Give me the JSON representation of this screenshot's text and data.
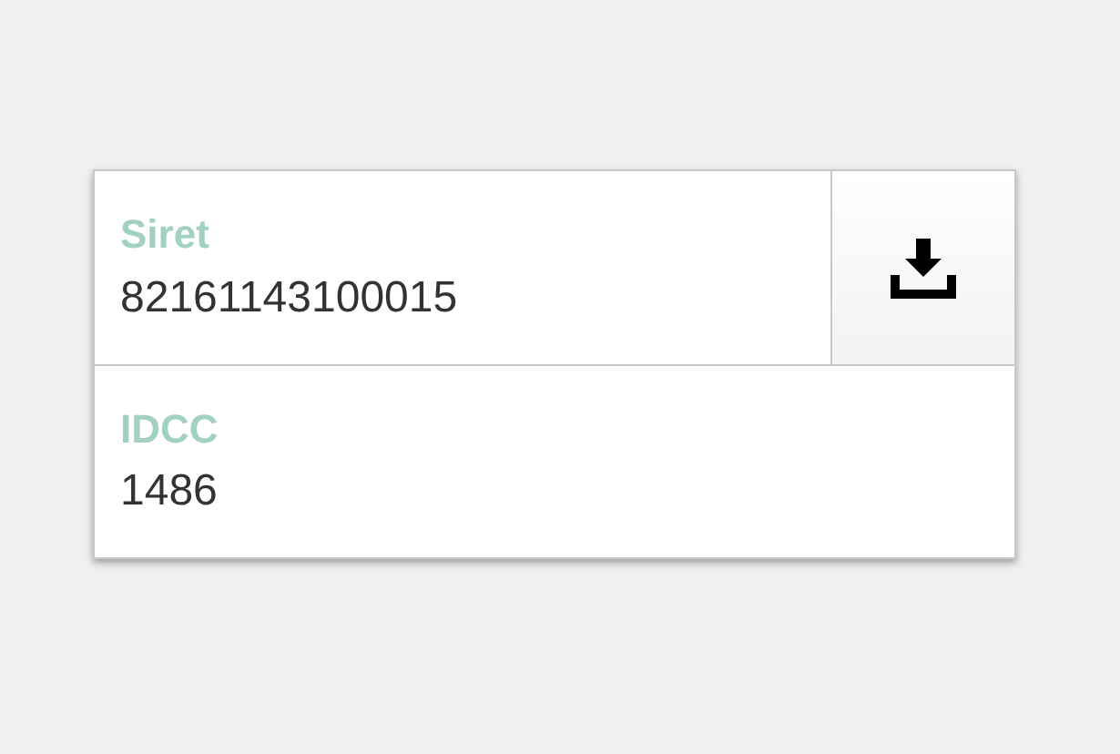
{
  "fields": [
    {
      "kind": "download",
      "label": "Siret",
      "value": "82161143100015"
    },
    {
      "kind": "plain",
      "label": "IDCC",
      "value": "1486"
    }
  ]
}
